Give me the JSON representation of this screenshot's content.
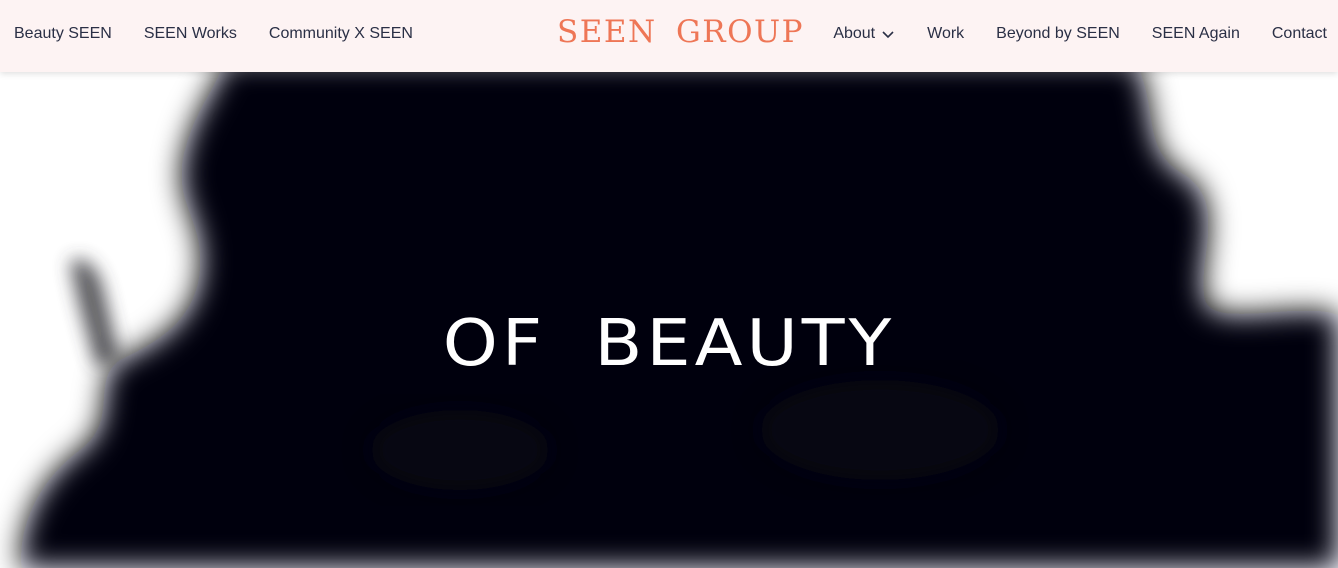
{
  "header": {
    "logo": "SEEN GROUP",
    "left_nav": [
      {
        "label": "Beauty SEEN"
      },
      {
        "label": "SEEN Works"
      },
      {
        "label": "Community X SEEN"
      }
    ],
    "right_nav": {
      "about": {
        "label": "About",
        "icon": "chevron-down-icon"
      },
      "items": [
        {
          "label": "Work"
        },
        {
          "label": "Beyond by SEEN"
        },
        {
          "label": "SEEN Again"
        },
        {
          "label": "Contact"
        }
      ]
    }
  },
  "hero": {
    "headline": "OF BEAUTY"
  },
  "colors": {
    "header_background": "#fdf3f3",
    "logo": "#ee7656",
    "nav_text": "#2a2f45",
    "hero_dark": "#05050c",
    "hero_text": "#ffffff"
  }
}
